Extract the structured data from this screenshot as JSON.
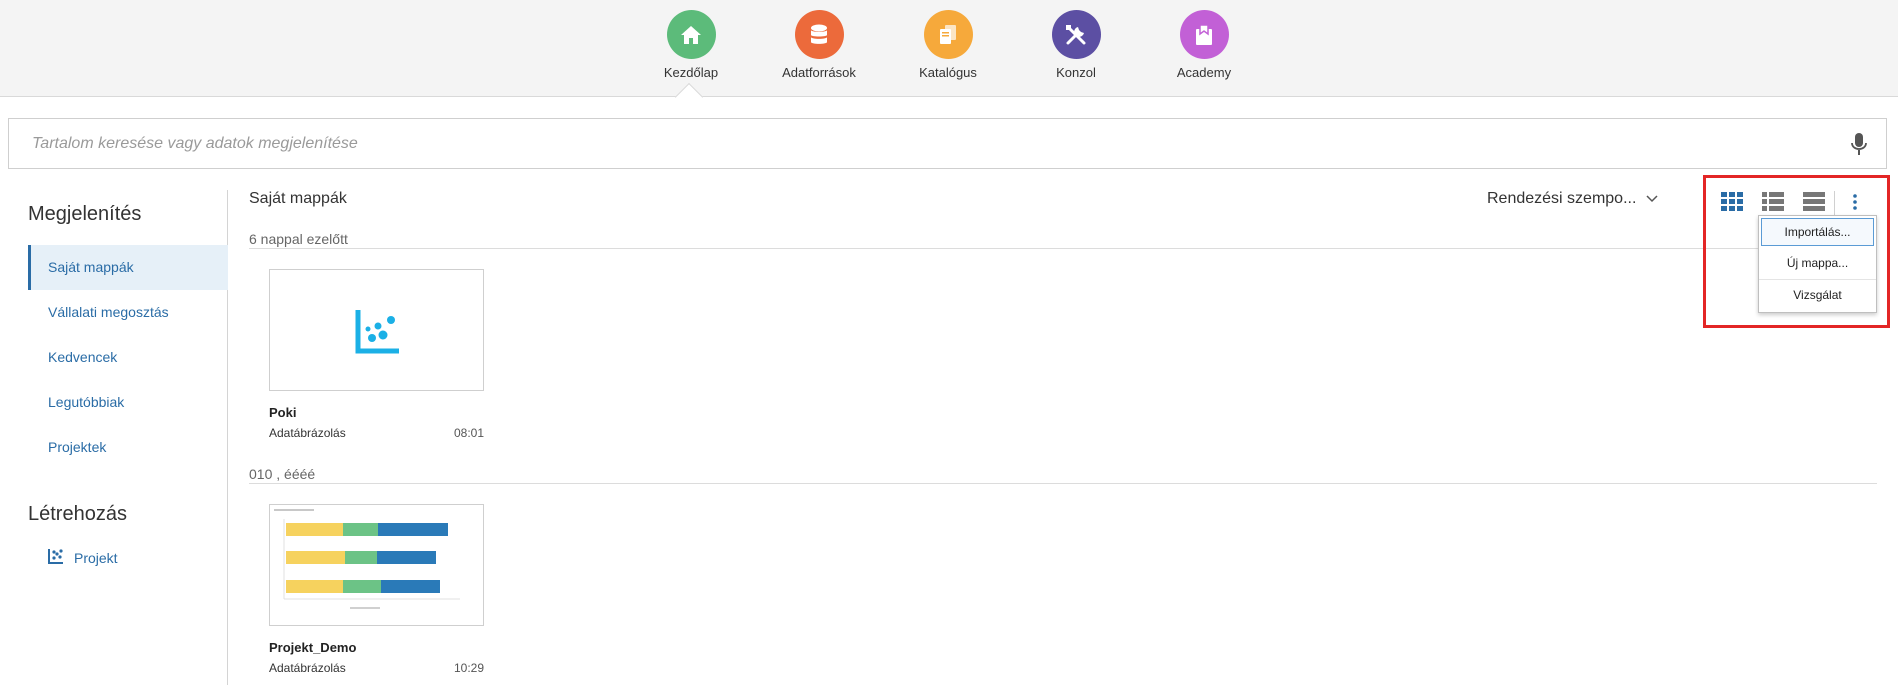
{
  "nav": {
    "items": [
      {
        "label": "Kezdőlap",
        "icon": "home-icon",
        "color": "#5cbb7a"
      },
      {
        "label": "Adatforrások",
        "icon": "database-icon",
        "color": "#ec6a3b"
      },
      {
        "label": "Katalógus",
        "icon": "catalog-icon",
        "color": "#f6a93b"
      },
      {
        "label": "Konzol",
        "icon": "tools-icon",
        "color": "#5c4fa3"
      },
      {
        "label": "Academy",
        "icon": "academy-icon",
        "color": "#c260d6"
      }
    ]
  },
  "search": {
    "placeholder": "Tartalom keresése vagy adatok megjelenítése"
  },
  "sidebar": {
    "display_heading": "Megjelenítés",
    "items": [
      {
        "label": "Saját mappák"
      },
      {
        "label": "Vállalati megosztás"
      },
      {
        "label": "Kedvencek"
      },
      {
        "label": "Legutóbbiak"
      },
      {
        "label": "Projektek"
      }
    ],
    "create_heading": "Létrehozás",
    "create_item": "Projekt"
  },
  "main": {
    "title": "Saját mappák",
    "sort_label": "Rendezési szempo...",
    "groups": [
      {
        "heading": "6 nappal ezelőtt"
      },
      {
        "heading": "010 , éééé"
      }
    ],
    "cards": [
      {
        "name": "Poki",
        "type": "Adatábrázolás",
        "time": "08:01"
      },
      {
        "name": "Projekt_Demo",
        "type": "Adatábrázolás",
        "time": "10:29"
      }
    ]
  },
  "menu": {
    "items": [
      "Importálás...",
      "Új mappa...",
      "Vizsgálat"
    ]
  },
  "colors": {
    "accent": "#2a6ca6",
    "highlight": "#e32626",
    "bar_yellow": "#f6d25e",
    "bar_green": "#6cc386",
    "bar_blue": "#2a7ab8",
    "scatter_icon": "#1bb0e6"
  }
}
